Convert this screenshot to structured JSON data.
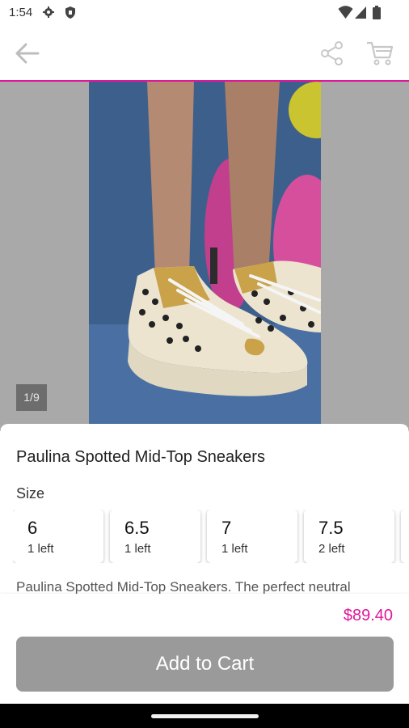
{
  "status": {
    "time": "1:54",
    "icons": [
      "gear-icon",
      "shield-icon",
      "wifi-icon",
      "signal-icon",
      "battery-icon"
    ]
  },
  "appbar": {
    "icons": [
      "back-arrow-icon",
      "share-icon",
      "cart-icon"
    ],
    "accent": "#e0179a"
  },
  "gallery": {
    "counter": "1/9"
  },
  "product": {
    "title": "Paulina Spotted Mid-Top Sneakers",
    "size_label": "Size",
    "sizes": [
      {
        "size": "6",
        "stock": "1 left"
      },
      {
        "size": "6.5",
        "stock": "1 left"
      },
      {
        "size": "7",
        "stock": "1 left"
      },
      {
        "size": "7.5",
        "stock": "2 left"
      }
    ],
    "description": "Paulina Spotted Mid-Top Sneakers. The perfect neutral",
    "price": "$89.40",
    "add_to_cart": "Add to Cart"
  }
}
